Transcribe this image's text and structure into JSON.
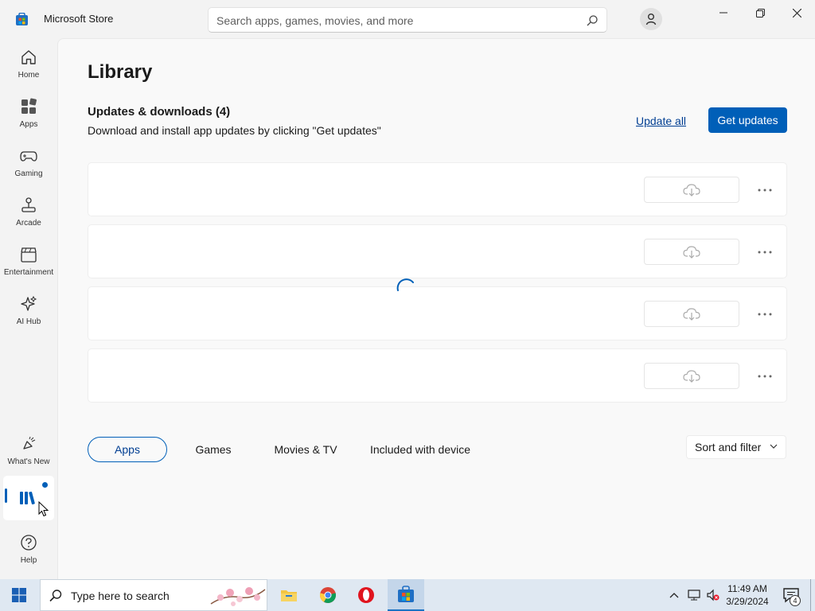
{
  "window": {
    "title": "Microsoft Store",
    "search_placeholder": "Search apps, games, movies, and more"
  },
  "nav": {
    "items": [
      {
        "label": "Home",
        "icon": "home-icon"
      },
      {
        "label": "Apps",
        "icon": "apps-icon"
      },
      {
        "label": "Gaming",
        "icon": "gamepad-icon"
      },
      {
        "label": "Arcade",
        "icon": "joystick-icon"
      },
      {
        "label": "Entertainment",
        "icon": "clapperboard-icon"
      },
      {
        "label": "AI Hub",
        "icon": "sparkle-icon"
      }
    ],
    "bottom": [
      {
        "label": "What's New",
        "icon": "megaphone-icon"
      },
      {
        "label": "Help",
        "icon": "help-icon"
      }
    ],
    "library_icon": "library-icon"
  },
  "library": {
    "title": "Library",
    "section_title": "Updates & downloads (4)",
    "section_sub": "Download and install app updates by clicking \"Get updates\"",
    "update_all": "Update all",
    "get_updates": "Get updates",
    "card_count": 4
  },
  "filters": {
    "chips": [
      "Apps",
      "Games",
      "Movies & TV",
      "Included with device"
    ],
    "selected": "Apps",
    "sort": "Sort and filter"
  },
  "taskbar": {
    "search_text": "Type here to search",
    "time": "11:49 AM",
    "date": "3/29/2024",
    "notification_count": "4"
  },
  "colors": {
    "accent": "#005fb8",
    "accent_dark": "#003e92"
  }
}
